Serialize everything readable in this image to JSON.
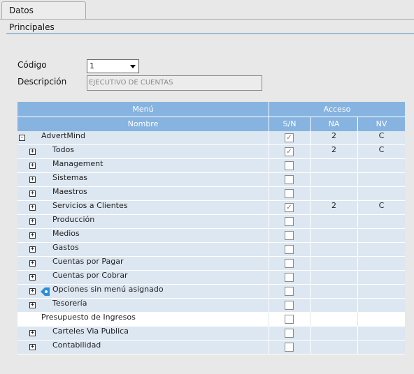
{
  "tab": {
    "label": "Datos Principales"
  },
  "form": {
    "codigo_label": "Código",
    "codigo_value": "1",
    "descripcion_label": "Descripción",
    "descripcion_value": "EJECUTIVO DE CUENTAS"
  },
  "grid": {
    "header_menu": "Menú",
    "header_acceso": "Acceso",
    "col_nombre": "Nombre",
    "col_sn": "S/N",
    "col_na": "NA",
    "col_nv": "NV",
    "rows": [
      {
        "name": "AdvertMind",
        "level": 0,
        "expander": "-",
        "checked": true,
        "na": "2",
        "nv": "C"
      },
      {
        "name": "Todos",
        "level": 1,
        "expander": "+",
        "checked": true,
        "na": "2",
        "nv": "C"
      },
      {
        "name": "Management",
        "level": 1,
        "expander": "+",
        "checked": false,
        "na": "",
        "nv": ""
      },
      {
        "name": "Sistemas",
        "level": 1,
        "expander": "+",
        "checked": false,
        "na": "",
        "nv": ""
      },
      {
        "name": "Maestros",
        "level": 1,
        "expander": "+",
        "checked": false,
        "na": "",
        "nv": ""
      },
      {
        "name": "Servicios a Clientes",
        "level": 1,
        "expander": "+",
        "checked": true,
        "na": "2",
        "nv": "C"
      },
      {
        "name": "Producción",
        "level": 1,
        "expander": "+",
        "checked": false,
        "na": "",
        "nv": ""
      },
      {
        "name": "Medios",
        "level": 1,
        "expander": "+",
        "checked": false,
        "na": "",
        "nv": ""
      },
      {
        "name": "Gastos",
        "level": 1,
        "expander": "+",
        "checked": false,
        "na": "",
        "nv": ""
      },
      {
        "name": "Cuentas por Pagar",
        "level": 1,
        "expander": "+",
        "checked": false,
        "na": "",
        "nv": ""
      },
      {
        "name": "Cuentas por Cobrar",
        "level": 1,
        "expander": "+",
        "checked": false,
        "na": "",
        "nv": ""
      },
      {
        "name": "Opciones sin menú asignado",
        "level": 1,
        "expander": "+",
        "icon": "warning-tag-icon",
        "checked": false,
        "na": "",
        "nv": ""
      },
      {
        "name": "Tesorería",
        "level": 1,
        "expander": "+",
        "checked": false,
        "na": "",
        "nv": ""
      },
      {
        "name": "Presupuesto de Ingresos",
        "level": 0,
        "expander": "",
        "checked": false,
        "na": "",
        "nv": "",
        "highlight": true
      },
      {
        "name": "Carteles Via Publica",
        "level": 1,
        "expander": "+",
        "checked": false,
        "na": "",
        "nv": ""
      },
      {
        "name": "Contabilidad",
        "level": 1,
        "expander": "+",
        "checked": false,
        "na": "",
        "nv": ""
      }
    ]
  }
}
